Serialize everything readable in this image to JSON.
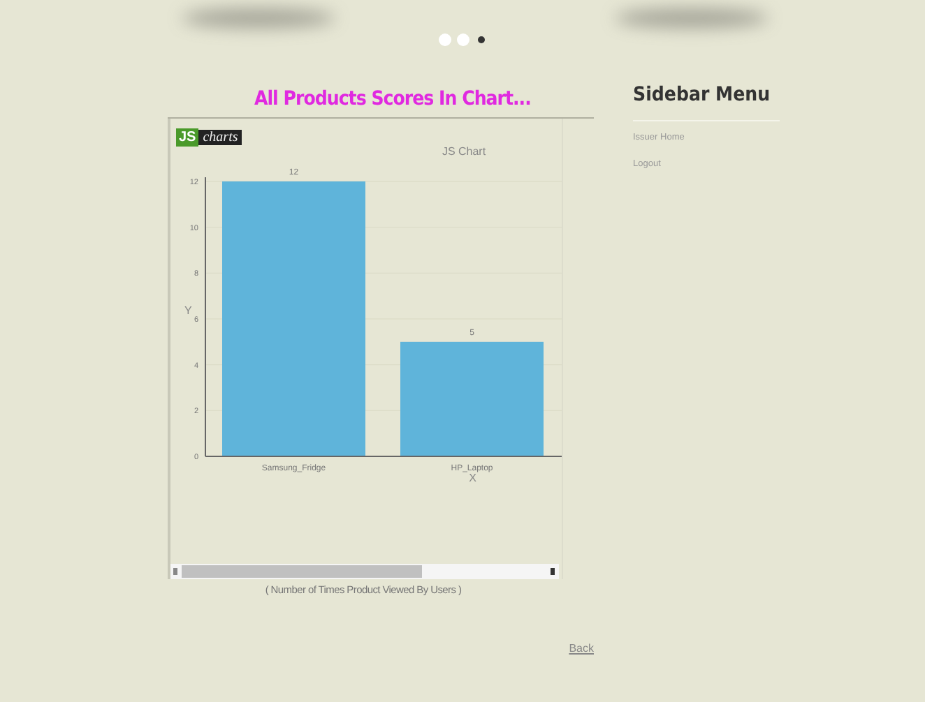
{
  "carousel_dots": [
    {
      "selected": false
    },
    {
      "selected": false
    },
    {
      "selected": true
    }
  ],
  "main": {
    "title": "All Products Scores In Chart...",
    "chart": {
      "logo": {
        "js": "JS",
        "word": "charts"
      },
      "chart_data": {
        "type": "bar",
        "title": "JS Chart",
        "xlabel": "X",
        "ylabel": "Y",
        "categories": [
          "Samsung_Fridge",
          "HP_Laptop"
        ],
        "series": [
          {
            "color": "#5fb4da",
            "values": [
              12,
              5
            ]
          }
        ],
        "ylim": [
          0,
          12
        ],
        "grid": true,
        "yticks": [
          0,
          2,
          4,
          6,
          8,
          10,
          12
        ],
        "data_labels": true
      },
      "caption": "( Number of Times Product Viewed By Users )"
    },
    "back_link": "Back"
  },
  "sidebar": {
    "title": "Sidebar Menu",
    "items": [
      "Issuer Home",
      "Logout"
    ]
  }
}
